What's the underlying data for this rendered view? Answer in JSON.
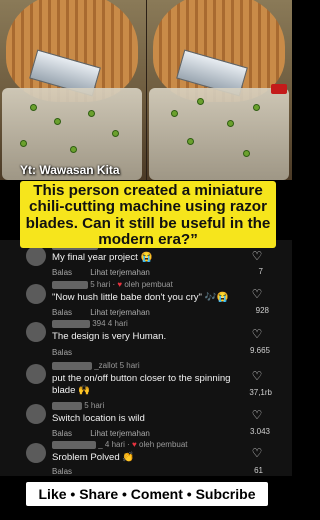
{
  "watermark": "Yt: Wawasan Kita",
  "caption": {
    "line1": "This person created a  miniature",
    "line2": "chili-cutting machine using razor",
    "line3": "blades. Can it still be useful in the",
    "line4": "modern era?”"
  },
  "labels": {
    "reply": "Balas",
    "translate": "Lihat terjemahan"
  },
  "comments": [
    {
      "time": "",
      "by_creator": "",
      "text": "My final year project 😭",
      "show_translate": true,
      "likes": "7"
    },
    {
      "time": "5 hari ·",
      "by_creator": "oleh pembuat",
      "text": "\"Now hush little babe don't you cry\" 🎶😭",
      "show_translate": true,
      "likes": "928"
    },
    {
      "time": "394 4 hari",
      "by_creator": "",
      "text": "The design is very Human.",
      "show_translate": false,
      "likes": "9.665"
    },
    {
      "time": "_zallot 5 hari",
      "by_creator": "",
      "text_line1": "put the on/off button closer to the spinning",
      "text_line2": "blade 🙌",
      "show_translate": false,
      "likes": "37,1rb"
    },
    {
      "time": "5 hari",
      "by_creator": "",
      "text": "Switch location is wild",
      "show_translate": true,
      "likes": "3.043"
    },
    {
      "time": "_ 4 hari ·",
      "by_creator": "oleh pembuat",
      "text": "Sroblem Polved 👏",
      "show_translate": false,
      "likes": "61"
    }
  ],
  "banner": "Like • Share • Coment • Subcribe",
  "icons": {
    "like": "heart-outline-icon",
    "creator_like": "heart-icon"
  },
  "colors": {
    "caption_bg": "#f6e51c",
    "banner_bg": "#ffffff",
    "list_bg": "#121212",
    "creator_heart": "#e8333f"
  }
}
